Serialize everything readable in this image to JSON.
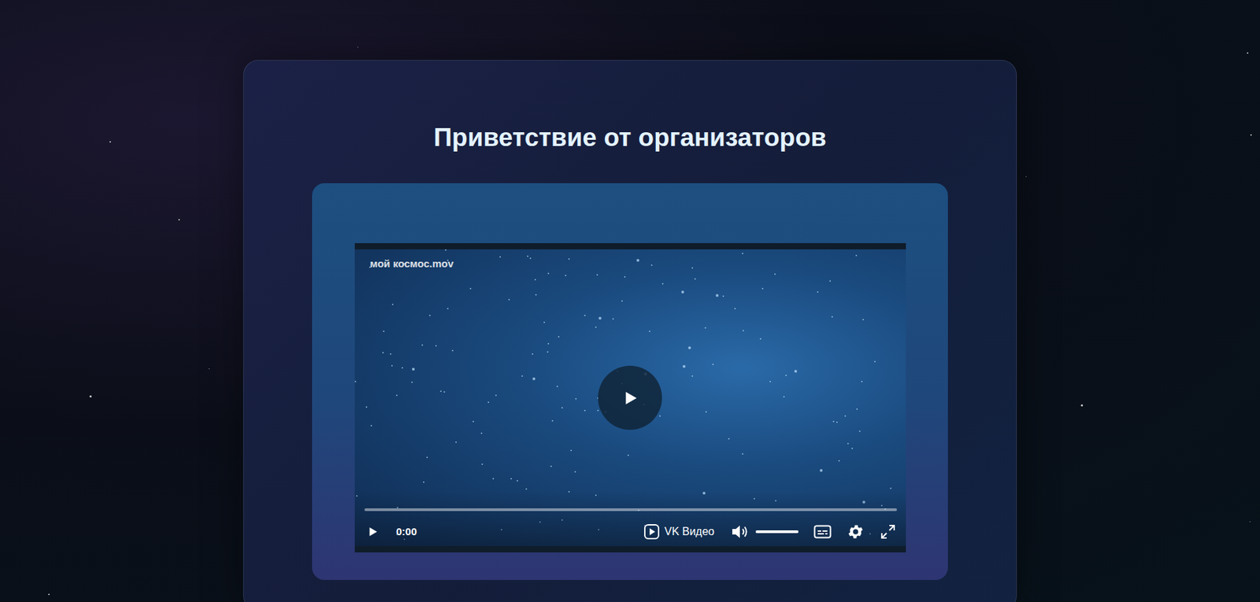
{
  "section": {
    "title": "Приветствие от организаторов"
  },
  "video": {
    "title": "мой космос.mov",
    "time": "0:00",
    "brand": "VK Видео",
    "progress": {
      "level": 0
    },
    "volume": {
      "level": 1
    },
    "playing": false
  }
}
